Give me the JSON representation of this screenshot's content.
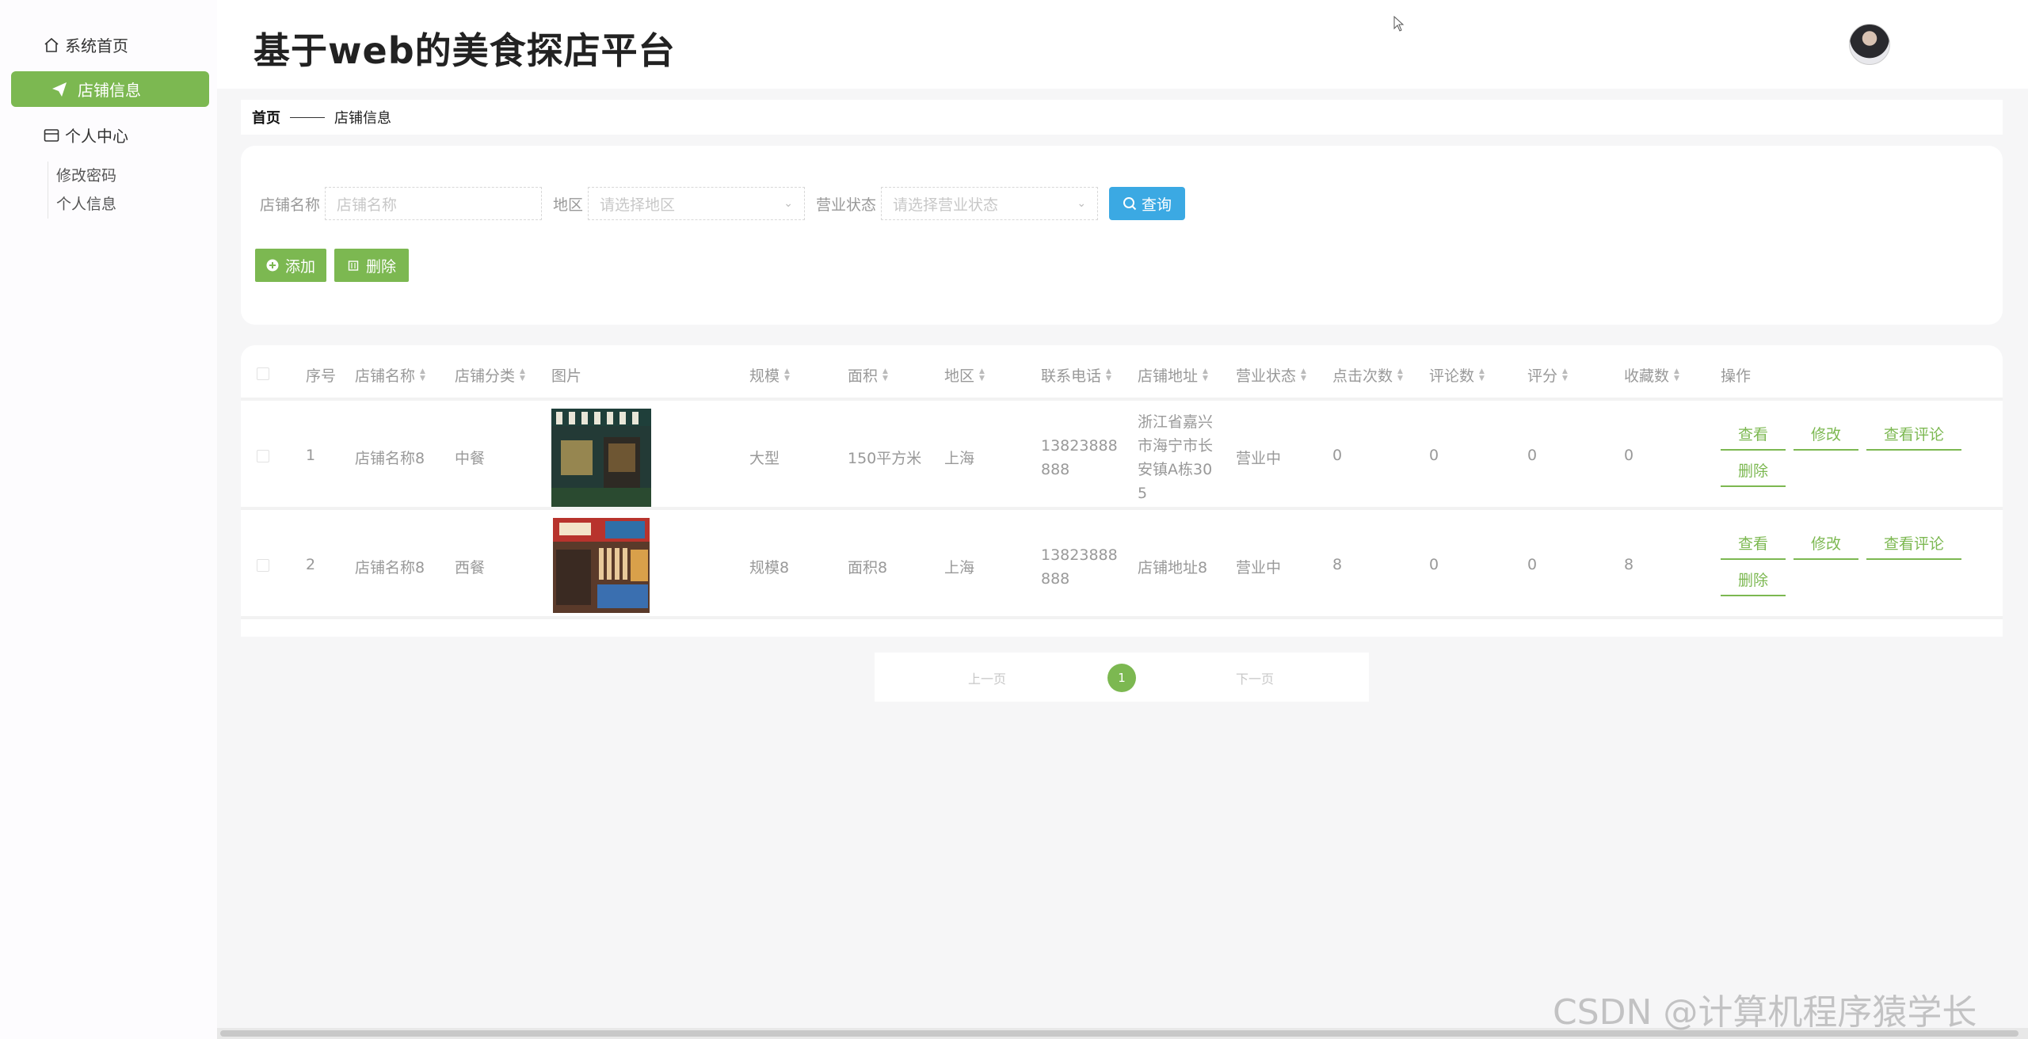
{
  "app": {
    "title": "基于web的美食探店平台"
  },
  "sidebar": {
    "items": [
      {
        "label": "系统首页",
        "icon": "home-icon"
      },
      {
        "label": "店铺信息",
        "icon": "paper-plane-icon",
        "active": true
      },
      {
        "label": "个人中心",
        "icon": "card-icon"
      }
    ],
    "sub_items": [
      "修改密码",
      "个人信息"
    ]
  },
  "breadcrumb": {
    "home": "首页",
    "current": "店铺信息"
  },
  "search": {
    "name_label": "店铺名称",
    "name_placeholder": "店铺名称",
    "region_label": "地区",
    "region_placeholder": "请选择地区",
    "status_label": "营业状态",
    "status_placeholder": "请选择营业状态",
    "query_label": "查询"
  },
  "actions": {
    "add_label": "添加",
    "delete_label": "删除"
  },
  "table": {
    "columns": [
      "序号",
      "店铺名称",
      "店铺分类",
      "图片",
      "规模",
      "面积",
      "地区",
      "联系电话",
      "店铺地址",
      "营业状态",
      "点击次数",
      "评论数",
      "评分",
      "收藏数",
      "操作"
    ],
    "rows": [
      {
        "index": "1",
        "name": "店铺名称8",
        "category": "中餐",
        "scale": "大型",
        "area": "150平方米",
        "region": "上海",
        "phone_line1": "13823888",
        "phone_line2": "888",
        "address_lines": [
          "浙江省嘉兴",
          "市海宁市长",
          "安镇A栋30",
          "5"
        ],
        "status": "营业中",
        "clicks": "0",
        "comments": "0",
        "rating": "0",
        "favorites": "0"
      },
      {
        "index": "2",
        "name": "店铺名称8",
        "category": "西餐",
        "scale": "规模8",
        "area": "面积8",
        "region": "上海",
        "phone_line1": "13823888",
        "phone_line2": "888",
        "address_lines": [
          "店铺地址8"
        ],
        "status": "营业中",
        "clicks": "8",
        "comments": "0",
        "rating": "0",
        "favorites": "8"
      }
    ],
    "ops": {
      "view": "查看",
      "edit": "修改",
      "view_comments": "查看评论",
      "delete": "删除"
    }
  },
  "pager": {
    "prev": "上一页",
    "current": "1",
    "next": "下一页"
  },
  "watermark": "CSDN @计算机程序猿学长",
  "colors": {
    "accent": "#7cb851",
    "query": "#3ba9e3"
  }
}
